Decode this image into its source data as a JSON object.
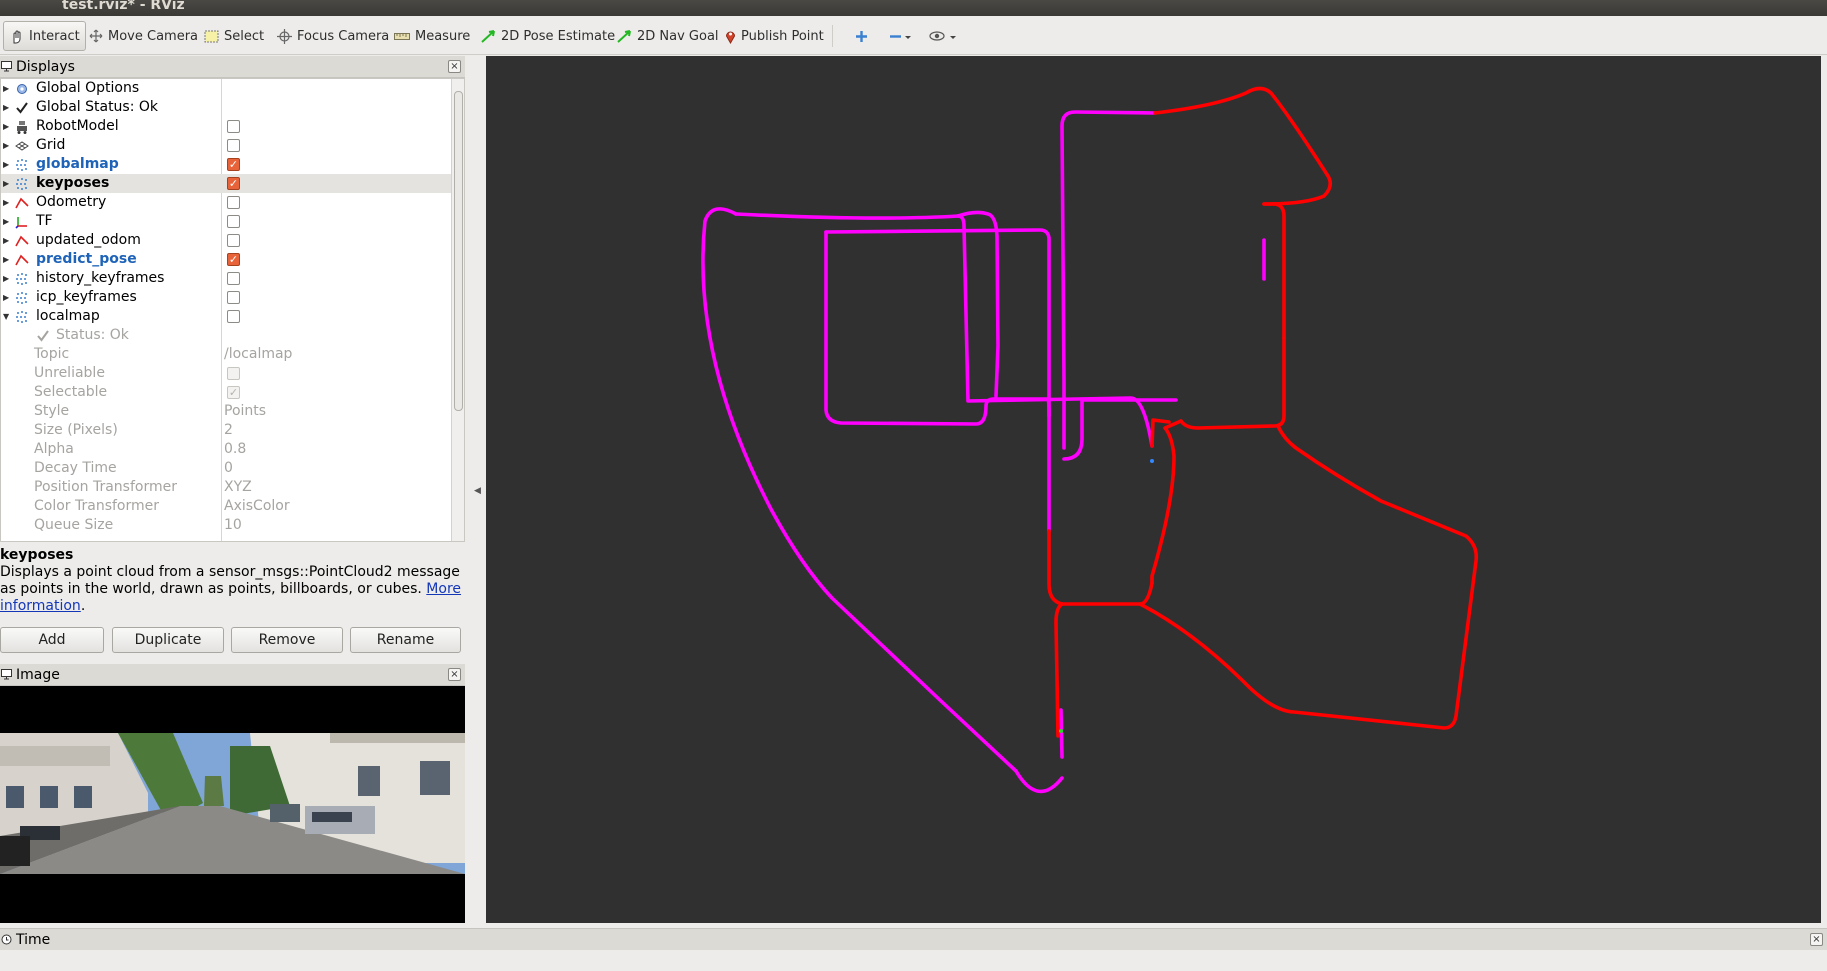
{
  "window": {
    "title": "test.rviz* - RViz"
  },
  "toolbar": {
    "tools": [
      {
        "label": "Interact",
        "icon": "hand-pointer-icon",
        "active": true
      },
      {
        "label": "Move Camera",
        "icon": "move-camera-icon"
      },
      {
        "label": "Select",
        "icon": "select-box-icon"
      },
      {
        "label": "Focus Camera",
        "icon": "focus-camera-icon"
      },
      {
        "label": "Measure",
        "icon": "ruler-icon"
      },
      {
        "label": "2D Pose Estimate",
        "icon": "green-arrow-icon"
      },
      {
        "label": "2D Nav Goal",
        "icon": "green-arrow-icon"
      },
      {
        "label": "Publish Point",
        "icon": "map-pin-icon"
      }
    ],
    "extra_icons": [
      "add-tool-icon",
      "remove-tool-icon",
      "view-options-icon"
    ]
  },
  "displays_panel": {
    "title": "Displays",
    "rows": [
      {
        "label": "Global Options",
        "icon": "gear-icon"
      },
      {
        "label": "Global Status: Ok",
        "icon": "checkmark-icon"
      },
      {
        "label": "RobotModel",
        "icon": "robot-icon",
        "checked": false
      },
      {
        "label": "Grid",
        "icon": "grid-icon",
        "checked": false
      },
      {
        "label": "globalmap",
        "icon": "pointcloud-icon",
        "checked": true
      },
      {
        "label": "keyposes",
        "icon": "pointcloud-icon",
        "checked": true,
        "selected": true
      },
      {
        "label": "Odometry",
        "icon": "odometry-icon",
        "checked": false
      },
      {
        "label": "TF",
        "icon": "tf-axes-icon",
        "checked": false
      },
      {
        "label": "updated_odom",
        "icon": "odometry-icon",
        "checked": false
      },
      {
        "label": "predict_pose",
        "icon": "odometry-icon",
        "checked": true
      },
      {
        "label": "history_keyframes",
        "icon": "pointcloud-icon",
        "checked": false
      },
      {
        "label": "icp_keyframes",
        "icon": "pointcloud-icon",
        "checked": false
      },
      {
        "label": "localmap",
        "icon": "pointcloud-icon",
        "checked": false,
        "expanded": true
      }
    ],
    "localmap_props": {
      "status": "Status: Ok",
      "topic_label": "Topic",
      "topic_value": "/localmap",
      "unreliable_label": "Unreliable",
      "selectable_label": "Selectable",
      "style_label": "Style",
      "style_value": "Points",
      "size_label": "Size (Pixels)",
      "size_value": "2",
      "alpha_label": "Alpha",
      "alpha_value": "0.8",
      "decay_label": "Decay Time",
      "decay_value": "0",
      "postf_label": "Position Transformer",
      "postf_value": "XYZ",
      "colortf_label": "Color Transformer",
      "colortf_value": "AxisColor",
      "queue_label": "Queue Size",
      "queue_value": "10"
    },
    "description": {
      "title": "keyposes",
      "text": "Displays a point cloud from a sensor_msgs::PointCloud2 message as points in the world, drawn as points, billboards, or cubes.",
      "link1": "More",
      "link2": "information",
      "tail": "."
    },
    "buttons": {
      "add": "Add",
      "duplicate": "Duplicate",
      "remove": "Remove",
      "rename": "Rename"
    }
  },
  "image_panel": {
    "title": "Image"
  },
  "time_panel": {
    "title": "Time"
  },
  "colors": {
    "background": "#303030",
    "trajectory_magenta": "#ff00ff",
    "trajectory_red": "#ff0000"
  }
}
